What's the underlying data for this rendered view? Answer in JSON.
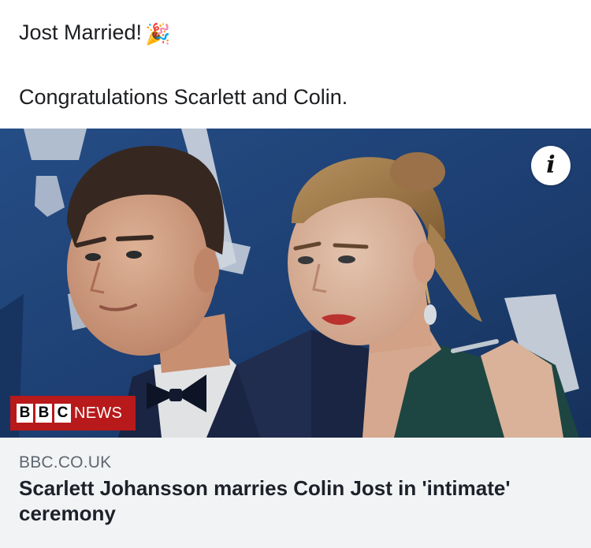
{
  "post": {
    "line1": "Jost Married!",
    "line1_emoji": "🎉",
    "line2": "Congratulations Scarlett and Colin."
  },
  "link_card": {
    "image_icon": "info-icon",
    "info_glyph": "i",
    "badge": {
      "letters": [
        "B",
        "B",
        "C"
      ],
      "word": "NEWS",
      "color": "#b8191a"
    },
    "domain": "BBC.CO.UK",
    "title": "Scarlett Johansson marries Colin Jost in 'intimate' ceremony"
  },
  "colors": {
    "post_background": "#ffffff",
    "meta_background": "#f2f3f5",
    "text": "#1c1e21",
    "muted_text": "#606770"
  }
}
